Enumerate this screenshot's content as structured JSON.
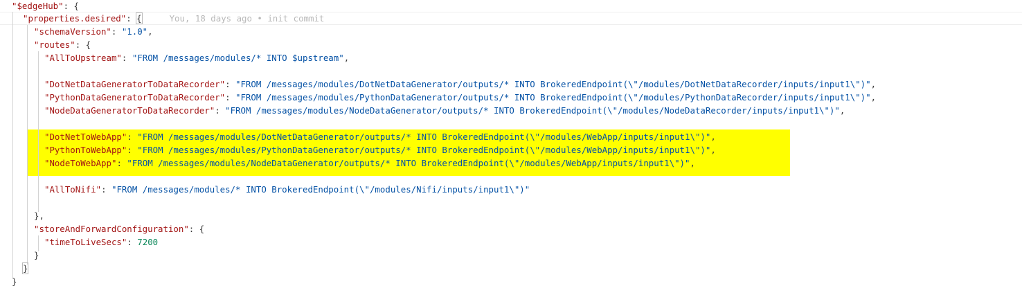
{
  "code": {
    "edgehub_key": "\"$edgeHub\"",
    "props_key": "\"properties.desired\"",
    "blame": "You, 18 days ago • init commit",
    "schema_key": "\"schemaVersion\"",
    "schema_val": "\"1.0\"",
    "routes_key": "\"routes\"",
    "r1_key": "\"AllToUpstream\"",
    "r1_val": "\"FROM /messages/modules/* INTO $upstream\"",
    "r2_key": "\"DotNetDataGeneratorToDataRecorder\"",
    "r2_val": "\"FROM /messages/modules/DotNetDataGenerator/outputs/* INTO BrokeredEndpoint(\\\"/modules/DotNetDataRecorder/inputs/input1\\\")\"",
    "r3_key": "\"PythonDataGeneratorToDataRecorder\"",
    "r3_val": "\"FROM /messages/modules/PythonDataGenerator/outputs/* INTO BrokeredEndpoint(\\\"/modules/PythonDataRecorder/inputs/input1\\\")\"",
    "r4_key": "\"NodeDataGeneratorToDataRecorder\"",
    "r4_val": "\"FROM /messages/modules/NodeDataGenerator/outputs/* INTO BrokeredEndpoint(\\\"/modules/NodeDataRecorder/inputs/input1\\\")\"",
    "r5_key": "\"DotNetToWebApp\"",
    "r5_val": "\"FROM /messages/modules/DotNetDataGenerator/outputs/* INTO BrokeredEndpoint(\\\"/modules/WebApp/inputs/input1\\\")\"",
    "r6_key": "\"PythonToWebApp\"",
    "r6_val": "\"FROM /messages/modules/PythonDataGenerator/outputs/* INTO BrokeredEndpoint(\\\"/modules/WebApp/inputs/input1\\\")\"",
    "r7_key": "\"NodeToWebApp\"",
    "r7_val": "\"FROM /messages/modules/NodeDataGenerator/outputs/* INTO BrokeredEndpoint(\\\"/modules/WebApp/inputs/input1\\\")\"",
    "r8_key": "\"AllToNifi\"",
    "r8_val": "\"FROM /messages/modules/* INTO BrokeredEndpoint(\\\"/modules/Nifi/inputs/input1\\\")\"",
    "store_key": "\"storeAndForwardConfiguration\"",
    "ttl_key": "\"timeToLiveSecs\"",
    "ttl_val": "7200"
  },
  "colors": {
    "key": "#a31515",
    "string": "#0451a5",
    "number": "#098658",
    "highlight": "#ffff00"
  }
}
